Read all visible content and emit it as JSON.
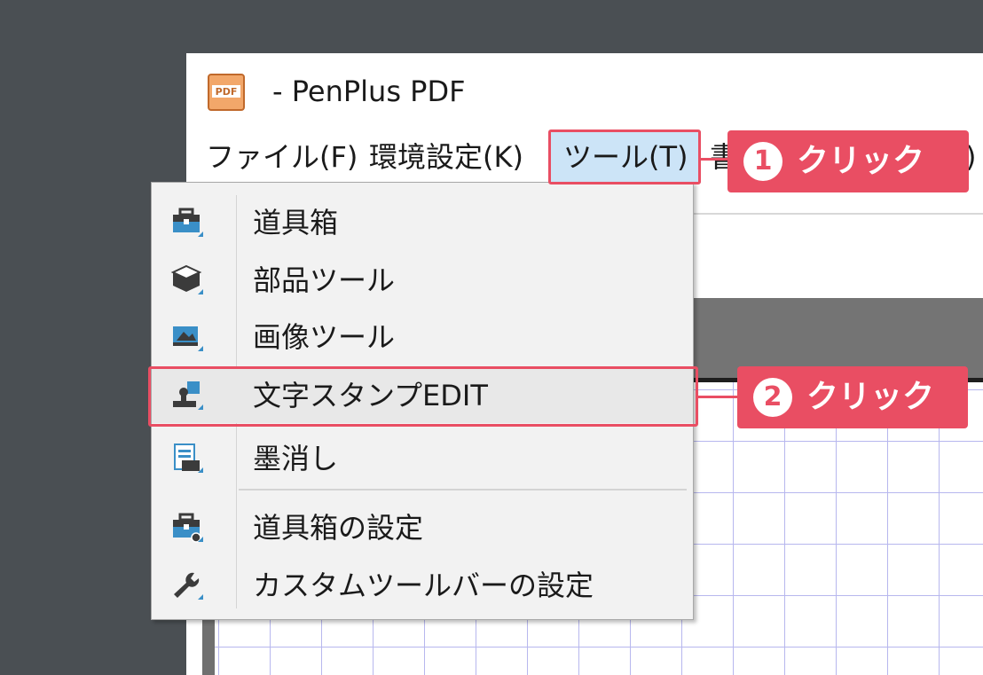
{
  "window": {
    "title": "- PenPlus PDF",
    "app_icon_text": "PDF"
  },
  "menubar": {
    "items": [
      {
        "label": "ファイル(F)"
      },
      {
        "label": "環境設定(K)"
      },
      {
        "label": "ツール(T)",
        "active": true
      },
      {
        "label": "書"
      },
      {
        "label": ")"
      }
    ]
  },
  "tool_menu": {
    "items": [
      {
        "label": "道具箱",
        "icon": "toolbox-icon"
      },
      {
        "label": "部品ツール",
        "icon": "parts-box-icon"
      },
      {
        "label": "画像ツール",
        "icon": "image-tool-icon"
      },
      {
        "label": "文字スタンプEDIT",
        "icon": "text-stamp-icon"
      },
      {
        "label": "墨消し",
        "icon": "redact-icon"
      },
      {
        "label": "道具箱の設定",
        "icon": "toolbox-settings-icon"
      },
      {
        "label": "カスタムツールバーの設定",
        "icon": "wrench-icon"
      }
    ]
  },
  "annotations": [
    {
      "number": "1",
      "text": "クリック"
    },
    {
      "number": "2",
      "text": "クリック"
    }
  ],
  "colors": {
    "accent": "#e94e63",
    "menu_active_bg": "#cce4f7",
    "icon_blue": "#3a8fc7",
    "icon_dark": "#3b3b3b"
  }
}
